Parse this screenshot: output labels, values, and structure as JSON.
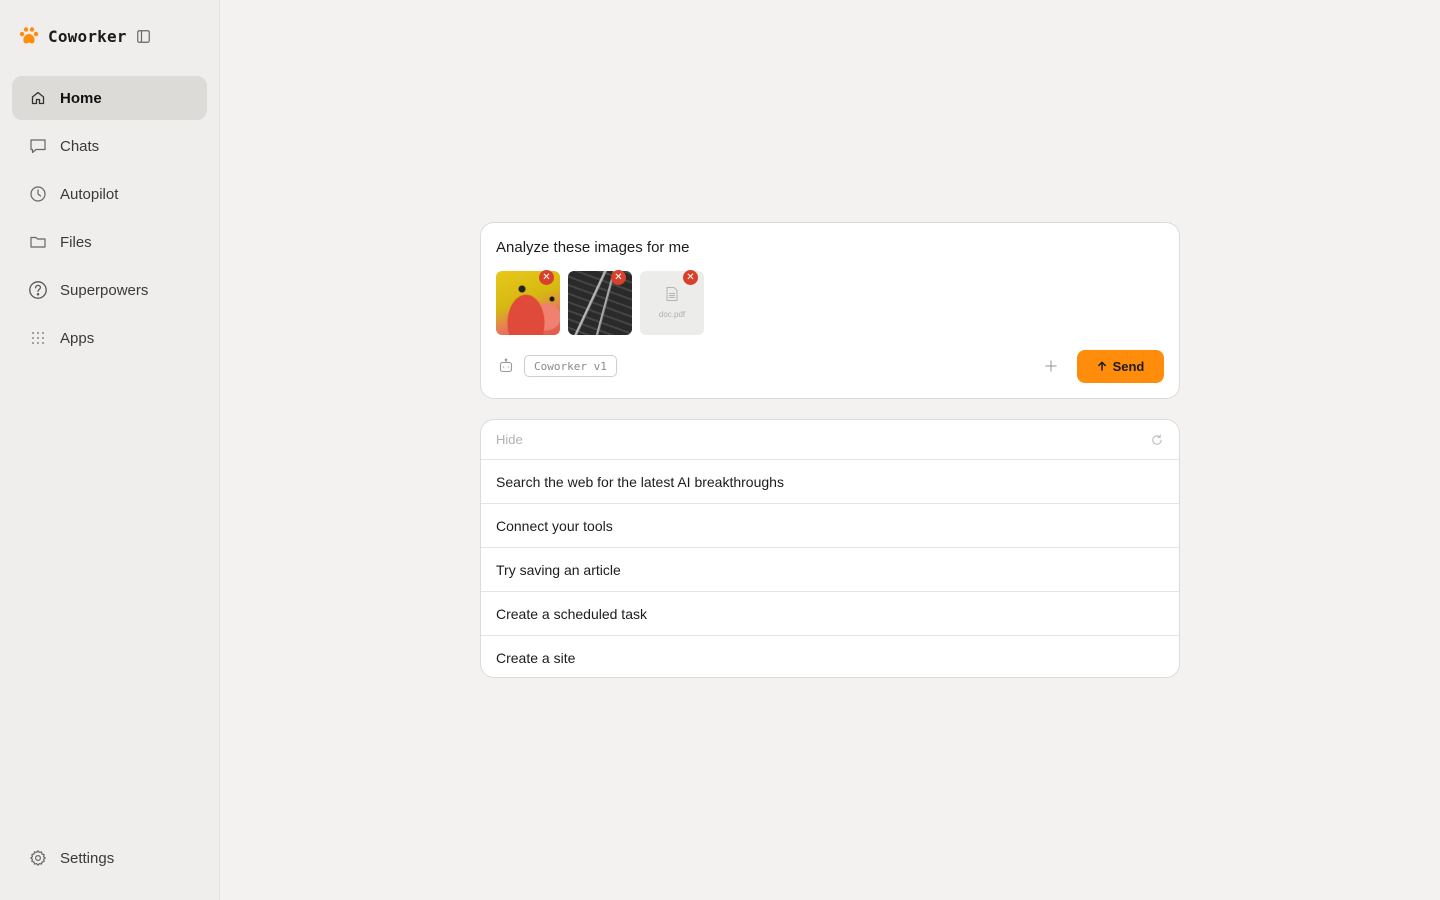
{
  "brand": {
    "name": "Coworker",
    "accent": "#ff8c0a"
  },
  "sidebar": {
    "items": [
      {
        "label": "Home",
        "icon": "home-icon",
        "active": true
      },
      {
        "label": "Chats",
        "icon": "chat-icon"
      },
      {
        "label": "Autopilot",
        "icon": "clock-icon"
      },
      {
        "label": "Files",
        "icon": "folder-icon"
      },
      {
        "label": "Superpowers",
        "icon": "help-circle-icon"
      },
      {
        "label": "Apps",
        "icon": "grid-icon"
      }
    ],
    "settings": {
      "label": "Settings",
      "icon": "gear-icon"
    }
  },
  "composer": {
    "prompt": "Analyze these images for me",
    "attachments": [
      {
        "type": "image",
        "name": "yellow-red-image"
      },
      {
        "type": "image",
        "name": "dark-architecture-image"
      },
      {
        "type": "file",
        "label": "doc.pdf"
      }
    ],
    "model": "Coworker v1",
    "send_label": "Send"
  },
  "suggestions": {
    "hide_label": "Hide",
    "items": [
      "Search the web for the latest AI breakthroughs",
      "Connect your tools",
      "Try saving an article",
      "Create a scheduled task",
      "Create a site"
    ]
  }
}
